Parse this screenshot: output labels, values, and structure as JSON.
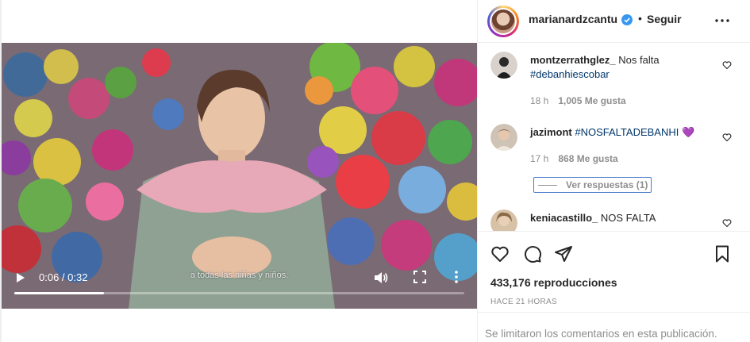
{
  "video": {
    "subtitle": "a todas las niñas y niños.",
    "time": "0:06 / 0:32",
    "progress": 0.2,
    "play_icon": "play-icon",
    "volume_icon": "volume-icon",
    "fullscreen_icon": "fullscreen-icon",
    "more_icon": "more-vertical-icon"
  },
  "header": {
    "username": "marianardzcantu",
    "dot": "•",
    "follow_label": "Seguir",
    "verified_color": "#3897f0"
  },
  "comments": [
    {
      "user": "montzerrathglez_",
      "text": " Nos falta ",
      "hashtag": "#debanhiescobar",
      "time": "18 h",
      "likes": "1,005 Me gusta"
    },
    {
      "user": "jazimont",
      "text": " ",
      "hashtag": "#NOSFALTADEBANHI",
      "emoji": "💜",
      "time": "17 h",
      "likes": "868 Me gusta",
      "replies": "Ver respuestas (1)"
    },
    {
      "user": "keniacastillo_",
      "text": " NOS FALTA"
    }
  ],
  "stats": {
    "views": "433,176 reproducciones",
    "ago": "HACE 21 HORAS"
  },
  "footer": {
    "limited": "Se limitaron los comentarios en esta publicación."
  }
}
